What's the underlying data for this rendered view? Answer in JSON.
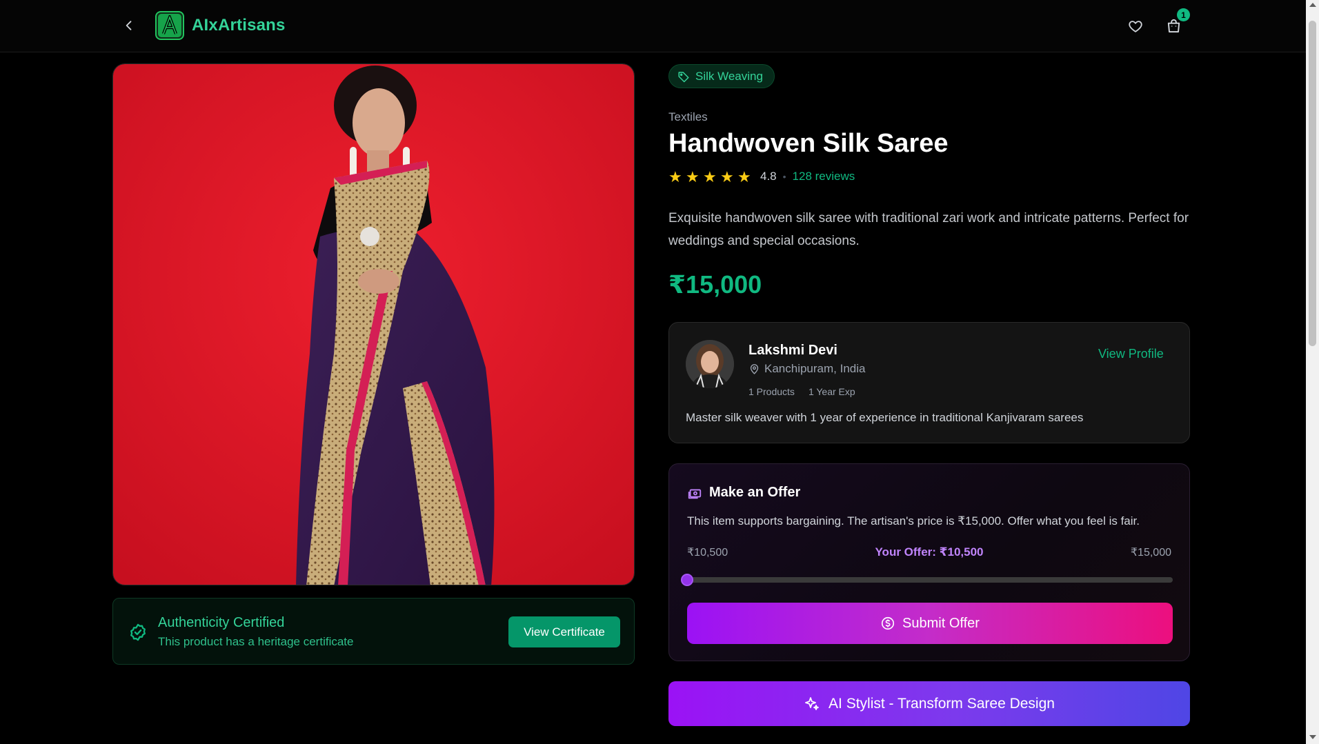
{
  "header": {
    "brand": "AIxArtisans",
    "cart_count": "1"
  },
  "product": {
    "tag": "Silk Weaving",
    "category": "Textiles",
    "title": "Handwoven Silk Saree",
    "rating": "4.8",
    "rating_stars": 5,
    "reviews": "128 reviews",
    "description": "Exquisite handwoven silk saree with traditional zari work and intricate patterns. Perfect for weddings and special occasions.",
    "price": "₹15,000"
  },
  "authenticity": {
    "title": "Authenticity Certified",
    "subtitle": "This product has a heritage certificate",
    "button": "View Certificate"
  },
  "artisan": {
    "name": "Lakshmi Devi",
    "location": "Kanchipuram, India",
    "products": "1 Products",
    "experience": "1 Year Exp",
    "view_profile": "View Profile",
    "bio": "Master silk weaver with 1 year of experience in traditional Kanjivaram sarees"
  },
  "offer": {
    "title": "Make an Offer",
    "text": "This item supports bargaining. The artisan's price is ₹15,000. Offer what you feel is fair.",
    "min_label": "₹10,500",
    "max_label": "₹15,000",
    "your_offer": "Your Offer: ₹10,500",
    "min_value": 10500,
    "max_value": 15000,
    "current_value": 10500,
    "submit": "Submit Offer"
  },
  "ai_stylist": {
    "label": "AI Stylist - Transform Saree Design"
  },
  "colors": {
    "accent": "#10b981",
    "offer_purple": "#9333ea",
    "star": "#facc15",
    "image_background": "#e11d2a"
  }
}
